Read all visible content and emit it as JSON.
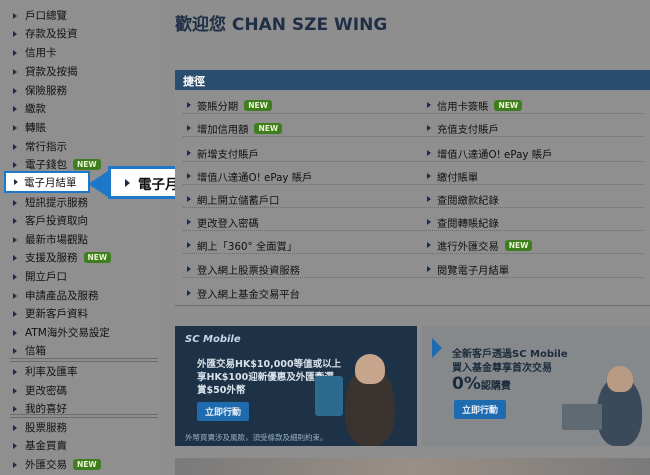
{
  "sidebar": {
    "items": [
      {
        "label": "戶口總覽",
        "badge": ""
      },
      {
        "label": "存款及投資",
        "badge": ""
      },
      {
        "label": "信用卡",
        "badge": ""
      },
      {
        "label": "貸款及按揭",
        "badge": ""
      },
      {
        "label": "保險服務",
        "badge": ""
      },
      {
        "label": "繳款",
        "badge": ""
      },
      {
        "label": "轉賬",
        "badge": ""
      },
      {
        "label": "常行指示",
        "badge": ""
      },
      {
        "label": "電子錢包",
        "badge": "NEW"
      },
      {
        "label": "電子月結單",
        "badge": ""
      },
      {
        "label": "短訊提示服務",
        "badge": ""
      },
      {
        "label": "客戶投資取向",
        "badge": ""
      },
      {
        "label": "最新市場觀點",
        "badge": ""
      },
      {
        "label": "支援及服務",
        "badge": "NEW"
      },
      {
        "label": "開立戶口",
        "badge": ""
      },
      {
        "label": "申請產品及服務",
        "badge": ""
      },
      {
        "label": "更新客戶資料",
        "badge": ""
      },
      {
        "label": "ATM海外交易設定",
        "badge": ""
      },
      {
        "label": "信箱",
        "badge": ""
      },
      {
        "label": "利率及匯率",
        "badge": ""
      },
      {
        "label": "更改密碼",
        "badge": ""
      },
      {
        "label": "我的喜好",
        "badge": ""
      },
      {
        "label": "股票服務",
        "badge": ""
      },
      {
        "label": "基金買賣",
        "badge": ""
      },
      {
        "label": "外匯交易",
        "badge": "NEW"
      }
    ],
    "highlighted": "電子月結單",
    "callout": "電子月結單"
  },
  "main": {
    "title": "歡迎您 CHAN SZE WING",
    "quicklinks": {
      "header": "捷徑",
      "left": [
        {
          "label": "簽賬分期",
          "badge": "NEW"
        },
        {
          "label": "增加信用額",
          "badge": "NEW"
        },
        {
          "label": "新增支付賬戶",
          "badge": ""
        },
        {
          "label": "增值八達通O! ePay 賬戶",
          "badge": ""
        },
        {
          "label": "網上開立儲蓄戶口",
          "badge": ""
        },
        {
          "label": "更改登入密碼",
          "badge": ""
        },
        {
          "label": "網上「360° 全面賞」",
          "badge": ""
        },
        {
          "label": "登入網上股票投資服務",
          "badge": ""
        },
        {
          "label": "登入網上基金交易平台",
          "badge": ""
        }
      ],
      "right": [
        {
          "label": "信用卡簽賬",
          "badge": "NEW"
        },
        {
          "label": "充值支付賬戶",
          "badge": ""
        },
        {
          "label": "增值八達通O! ePay 賬戶",
          "badge": ""
        },
        {
          "label": "繳付賬單",
          "badge": ""
        },
        {
          "label": "查閱繳款紀錄",
          "badge": ""
        },
        {
          "label": "查閱轉賬紀錄",
          "badge": ""
        },
        {
          "label": "進行外匯交易",
          "badge": "NEW"
        },
        {
          "label": "閱覽電子月結單",
          "badge": ""
        }
      ]
    },
    "banner_left": {
      "tag": "SC Mobile",
      "line1": "外匯交易HK$10,000等值或以上",
      "line2": "享HK$100迎新優惠及外匯牽選",
      "line3": "賞$50外幣",
      "cta": "立即行動",
      "foot": "外幣買賣涉及風險，須受條款及細則約束。"
    },
    "banner_right": {
      "line1": "全新客戶透過SC Mobile",
      "line2": "買入基金尊享首次交易",
      "line3": "0%",
      "line3_suffix": "認購費",
      "cta": "立即行動"
    }
  }
}
